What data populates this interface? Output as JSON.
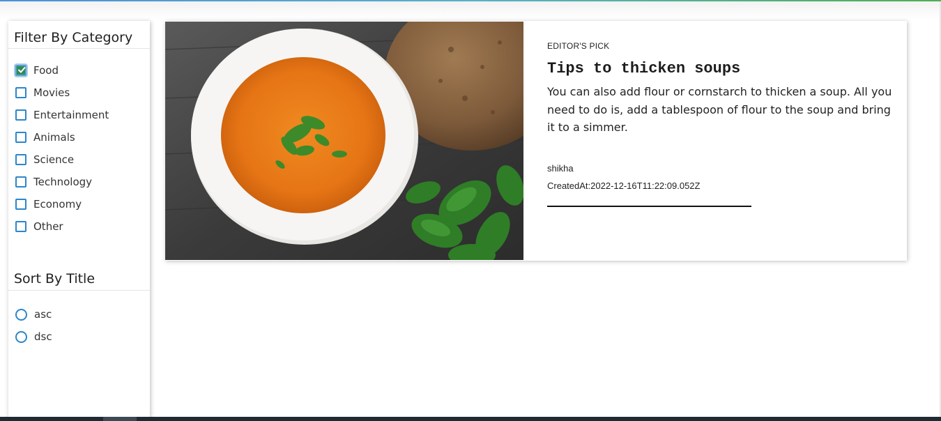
{
  "filter": {
    "title": "Filter By Category",
    "categories": [
      {
        "label": "Food",
        "checked": true
      },
      {
        "label": "Movies",
        "checked": false
      },
      {
        "label": "Entertainment",
        "checked": false
      },
      {
        "label": "Animals",
        "checked": false
      },
      {
        "label": "Science",
        "checked": false
      },
      {
        "label": "Technology",
        "checked": false
      },
      {
        "label": "Economy",
        "checked": false
      },
      {
        "label": "Other",
        "checked": false
      }
    ]
  },
  "sort": {
    "title": "Sort By Title",
    "options": [
      {
        "label": "asc",
        "selected": false
      },
      {
        "label": "dsc",
        "selected": false
      }
    ]
  },
  "post": {
    "tag": "EDITOR'S PICK",
    "title": "Tips to thicken soups",
    "body": "You can also add flour or cornstarch to thicken a soup. All you need to do is, add a tablespoon of flour to the soup and bring it to a simmer.",
    "author": "shikha",
    "created_at": "CreatedAt:2022-12-16T11:22:09.052Z",
    "image": "tomato-soup-bowl-with-bread-and-basil"
  },
  "colors": {
    "accent": "#2c86c9",
    "checked": "#2e8b57"
  }
}
